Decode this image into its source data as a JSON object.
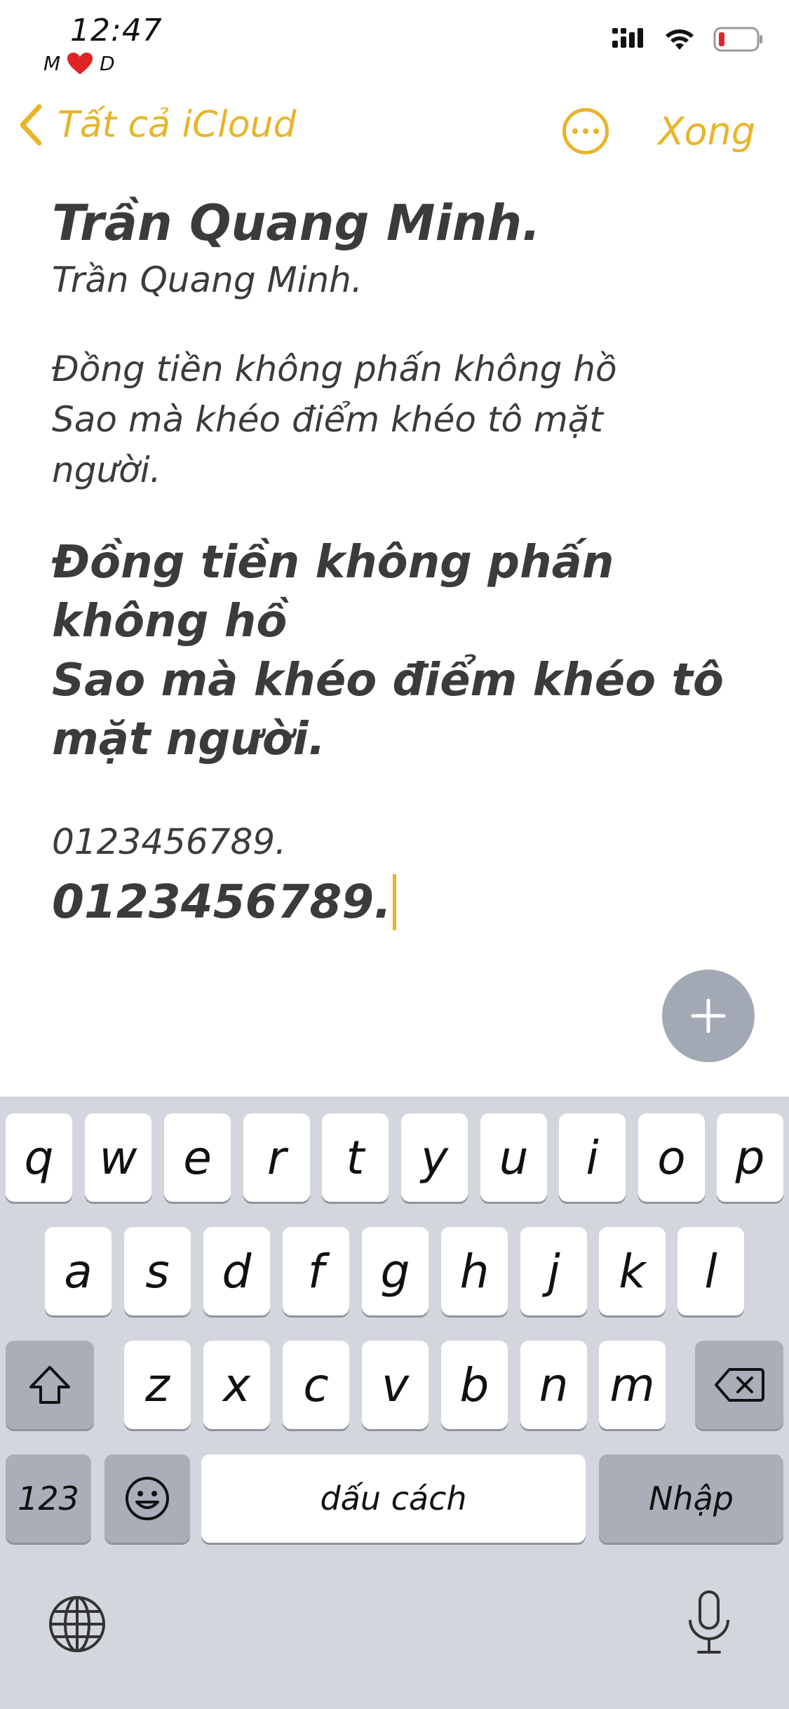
{
  "status": {
    "time": "12:47",
    "carrier_left": "M",
    "carrier_right": "D"
  },
  "nav": {
    "back_label": "Tất cả iCloud",
    "done_label": "Xong"
  },
  "note": {
    "title": "Trần Quang Minh.",
    "subtitle": "Trần Quang Minh.",
    "paragraph_regular": "Đồng tiền không phấn không hồ Sao mà khéo điểm khéo tô mặt người.",
    "paragraph_bold": "Đồng tiền không phấn không hồ\nSao mà khéo điểm khéo tô mặt người.",
    "numbers_small": "0123456789.",
    "numbers_big": "0123456789."
  },
  "keyboard": {
    "row1": [
      "q",
      "w",
      "e",
      "r",
      "t",
      "y",
      "u",
      "i",
      "o",
      "p"
    ],
    "row2": [
      "a",
      "s",
      "d",
      "f",
      "g",
      "h",
      "j",
      "k",
      "l"
    ],
    "row3": [
      "z",
      "x",
      "c",
      "v",
      "b",
      "n",
      "m"
    ],
    "numbers_key": "123",
    "space_key": "dấu cách",
    "return_key": "Nhập"
  },
  "colors": {
    "accent": "#e8b52a",
    "text": "#3b3b3b",
    "keyboard_bg": "#d3d6dd",
    "fab": "#a3a9b4"
  },
  "icons": [
    "signal-icon",
    "wifi-icon",
    "battery-icon",
    "chevron-left-icon",
    "more-icon",
    "plus-icon",
    "shift-icon",
    "delete-icon",
    "emoji-icon",
    "globe-icon",
    "microphone-icon"
  ]
}
